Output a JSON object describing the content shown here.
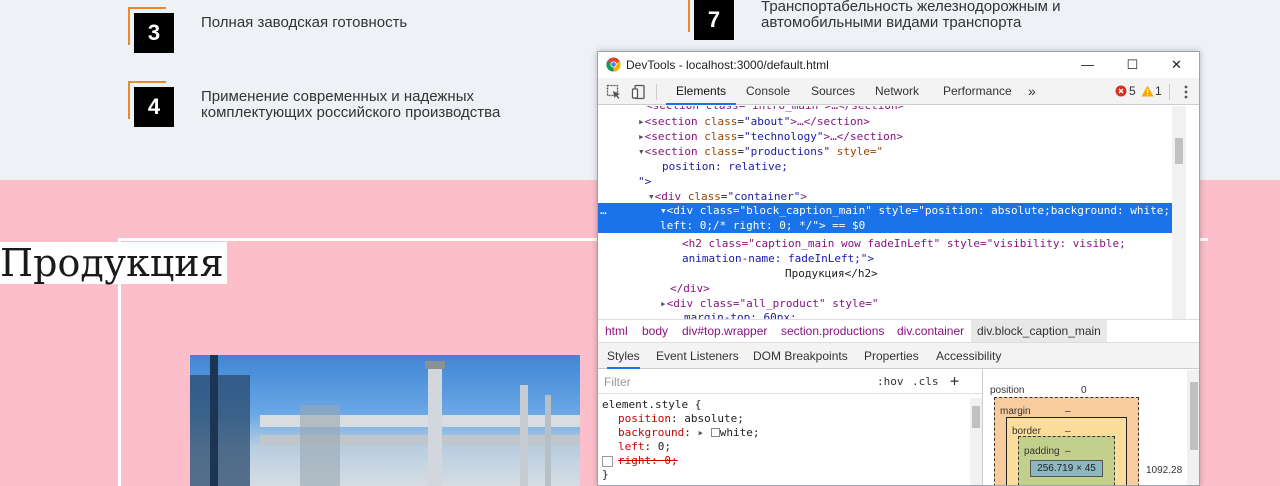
{
  "features": [
    {
      "number": "3",
      "text": "Полная заводская готовность"
    },
    {
      "number": "4",
      "text_line1": "Применение современных и надежных",
      "text_line2": "комплектующих российского производства"
    },
    {
      "number": "7",
      "text_line1": "Транспортабельность железнодорожным и",
      "text_line2": "автомобильными видами транспорта"
    }
  ],
  "section": {
    "title": "Продукция"
  },
  "devtools": {
    "window_title": "DevTools - localhost:3000/default.html",
    "tabs": [
      "Elements",
      "Console",
      "Sources",
      "Network",
      "Performance"
    ],
    "more_tabs": "»",
    "errors": "5",
    "warnings": "1",
    "dom_lines": [
      {
        "pre": "  ",
        "open": "<section ",
        "attr": "class",
        "val": "\"about\"",
        "close": ">…</section>"
      },
      {
        "pre": "  ",
        "open": "<section ",
        "attr": "class",
        "val": "\"technology\"",
        "close": ">…</section>"
      },
      {
        "pre": "  ",
        "open": "<section ",
        "attr": "class",
        "val": "\"productions\"",
        "close": " style=\""
      },
      {
        "text": "position: relative;"
      },
      {
        "text": "\">"
      },
      {
        "pre": "",
        "open": "<div ",
        "attr": "class",
        "val": "\"container\"",
        "close": ">"
      }
    ],
    "selected_line1": "<div class=\"block_caption_main\" style=\"position: absolute;background: white;",
    "selected_line2": "left: 0;/* right: 0; */\"> == $0",
    "after_lines": [
      "<h2 class=\"caption_main wow fadeInLeft\" style=\"visibility: visible;",
      "animation-name: fadeInLeft;\">",
      "Продукция</h2>",
      "</div>",
      "<div class=\"all_product\" style=\"",
      "margin-top: 60px;"
    ],
    "breadcrumbs": [
      "html",
      "body",
      "div#top.wrapper",
      "section.productions",
      "div.container",
      "div.block_caption_main"
    ],
    "subtabs": [
      "Styles",
      "Event Listeners",
      "DOM Breakpoints",
      "Properties",
      "Accessibility"
    ],
    "filter_placeholder": "Filter",
    "filter_tools": [
      ":hov",
      ".cls",
      "+"
    ],
    "css_rule": {
      "selector": "element.style {",
      "lines": [
        {
          "prop": "position",
          "value": "absolute;"
        },
        {
          "prop": "background",
          "value": "white;"
        },
        {
          "prop": "left",
          "value": "0;"
        },
        {
          "prop": "right",
          "value": "0;"
        }
      ],
      "close": "}"
    },
    "box_model": {
      "position_label": "position",
      "position_value": "0",
      "margin_label": "margin",
      "margin_value": "–",
      "border_label": "border",
      "border_value": "–",
      "padding_label": "padding",
      "padding_value": "–",
      "content": "256.719 × 45",
      "right_value": "1092.28"
    }
  },
  "colors": {
    "accent": "#e98a2c",
    "pink": "#fcbfca",
    "devtools_blue": "#1a73e8"
  }
}
